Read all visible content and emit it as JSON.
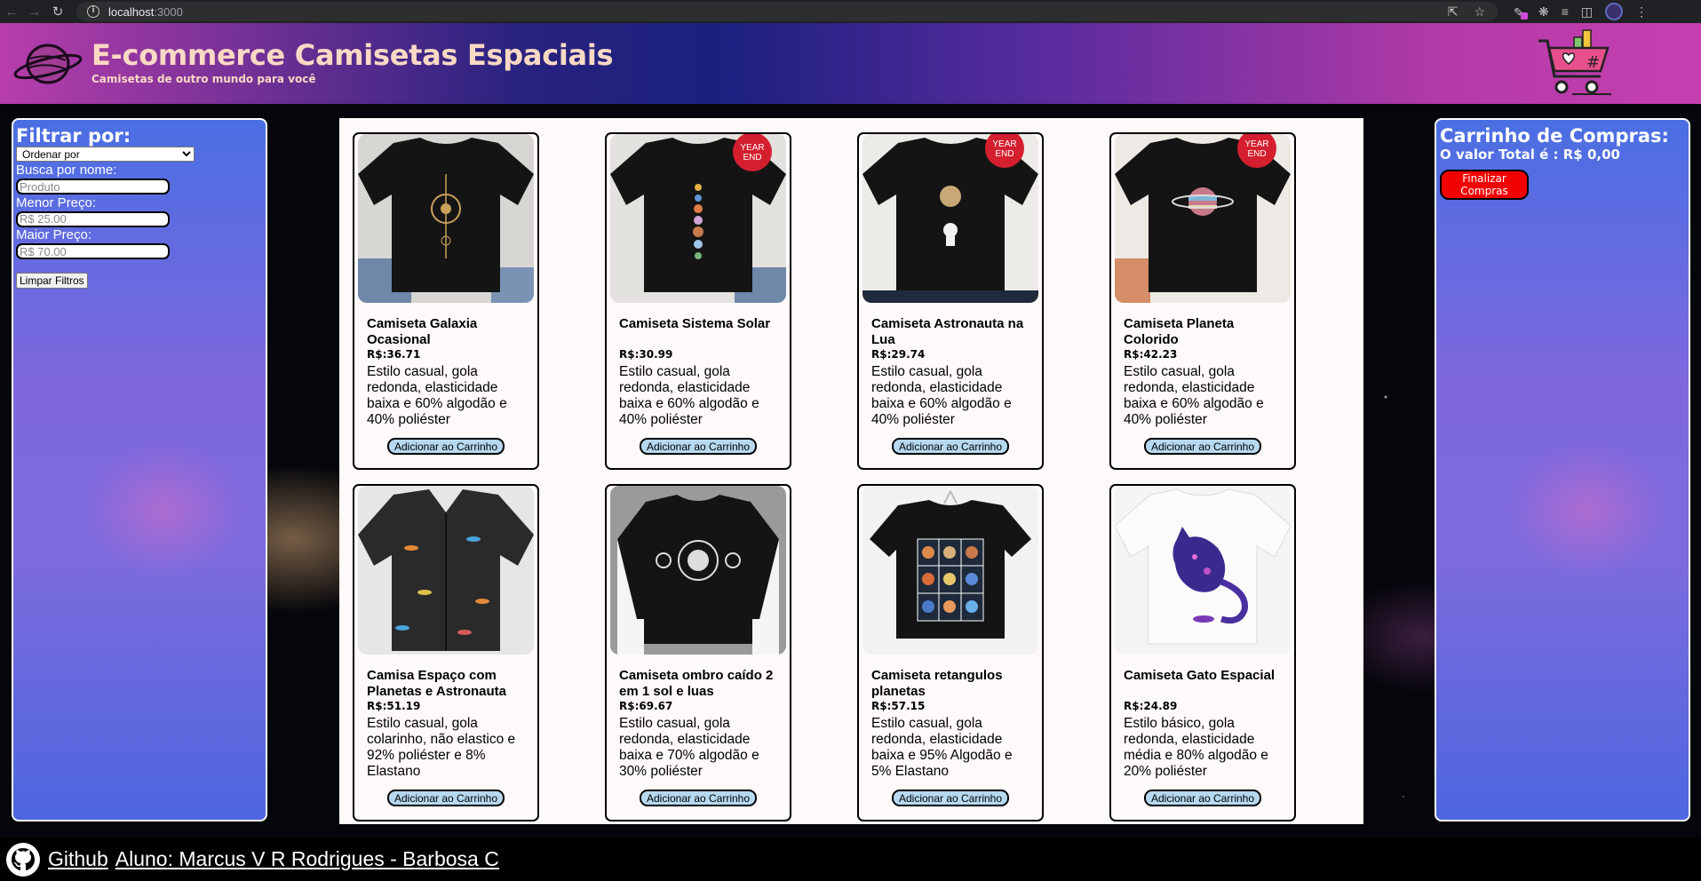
{
  "browser": {
    "url_host": "localhost",
    "url_port": ":3000"
  },
  "header": {
    "title": "E-commerce Camisetas Espaciais",
    "subtitle": "Camisetas de outro mundo para você"
  },
  "filters": {
    "title": "Filtrar por:",
    "order_selected": "Ordenar por",
    "search_label": "Busca por nome:",
    "search_placeholder": "Produto",
    "min_label": "Menor Preço:",
    "min_placeholder": "R$ 25.00",
    "max_label": "Maior Preço:",
    "max_placeholder": "R$ 70.00",
    "clear_label": "Limpar Filtros"
  },
  "cart": {
    "title": "Carrinho de Compras:",
    "total": "O valor Total é : R$ 0,00",
    "finish_label": "Finalizar Compras"
  },
  "products": [
    {
      "name": "Camiseta Galaxia Ocasional",
      "price": "R$:36.71",
      "desc": "Estilo casual, gola redonda, elasticidade baixa e 60% algodão e 40% poliéster",
      "button": "Adicionar ao Carrinho",
      "icon": "galaxy-shirt"
    },
    {
      "name": "Camiseta Sistema Solar",
      "price": "R$:30.99",
      "desc": "Estilo casual, gola redonda, elasticidade baixa e 60% algodão e 40% poliéster",
      "button": "Adicionar ao Carrinho",
      "icon": "solar-system-shirt",
      "badge": "YEAR END"
    },
    {
      "name": "Camiseta Astronauta na Lua",
      "price": "R$:29.74",
      "desc": "Estilo casual, gola redonda, elasticidade baixa e 60% algodão e 40% poliéster",
      "button": "Adicionar ao Carrinho",
      "icon": "astronaut-shirt",
      "badge": "YEAR END"
    },
    {
      "name": "Camiseta Planeta Colorido",
      "price": "R$:42.23",
      "desc": "Estilo casual, gola redonda, elasticidade baixa e 60% algodão e 40% poliéster",
      "button": "Adicionar ao Carrinho",
      "icon": "planet-shirt",
      "badge": "YEAR END"
    },
    {
      "name": "Camisa Espaço com Planetas e Astronauta",
      "price": "R$:51.19",
      "desc": "Estilo casual, gola colarinho, não elastico e 92% poliéster e 8% Elastano",
      "button": "Adicionar ao Carrinho",
      "icon": "space-button-shirt"
    },
    {
      "name": "Camiseta ombro caído 2 em 1 sol e luas",
      "price": "R$:69.67",
      "desc": "Estilo casual, gola redonda, elasticidade baixa e 70% algodão e 30% poliéster",
      "button": "Adicionar ao Carrinho",
      "icon": "sun-moon-shirt"
    },
    {
      "name": "Camiseta retangulos planetas",
      "price": "R$:57.15",
      "desc": "Estilo casual, gola redonda, elasticidade baixa e 95% Algodão e 5% Elastano",
      "button": "Adicionar ao Carrinho",
      "icon": "planet-grid-shirt"
    },
    {
      "name": "Camiseta Gato Espacial",
      "price": "R$:24.89",
      "desc": "Estilo básico, gola redonda, elasticidade média e 80% algodão e 20% poliéster",
      "button": "Adicionar ao Carrinho",
      "icon": "space-cat-shirt"
    }
  ],
  "footer": {
    "github_label": "Github",
    "author_label": "Aluno: Marcus V R Rodrigues - Barbosa C"
  }
}
